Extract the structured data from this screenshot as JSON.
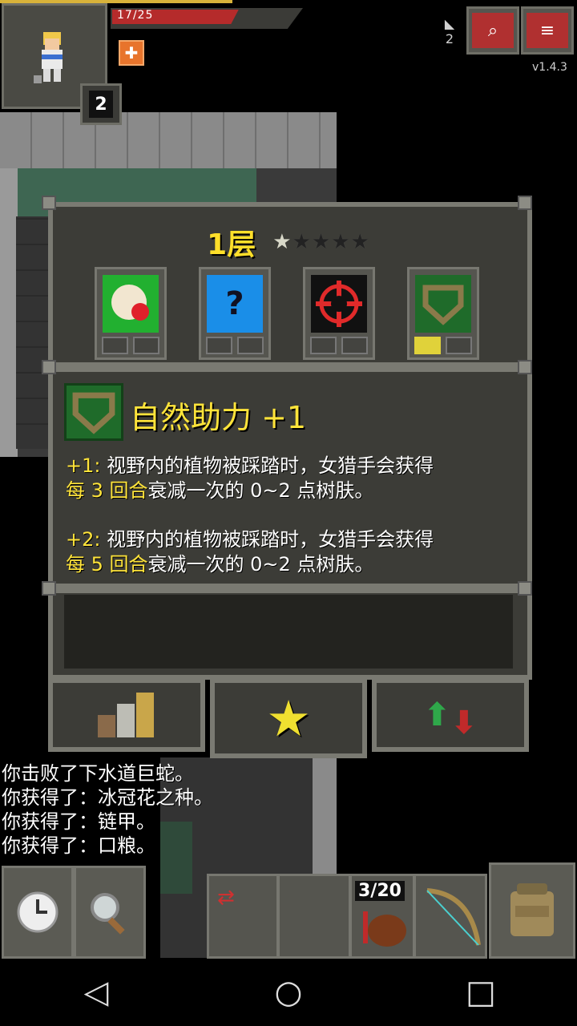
{
  "status": {
    "hp_text": "17/25",
    "hp_fraction": 0.68,
    "level": "2",
    "depth": "2",
    "version": "v1.4.3",
    "buff_icon": "plus-buff-icon"
  },
  "top_buttons": [
    {
      "name": "journal-search-button",
      "icon": "magnifier-book-icon"
    },
    {
      "name": "menu-button",
      "icon": "menu-lines-icon"
    }
  ],
  "window": {
    "floor_label": "1层",
    "stars": [
      "on",
      "off",
      "off",
      "off",
      "off"
    ],
    "talent_slots": [
      {
        "name": "talent-slot-1",
        "icon": "food-plate-icon",
        "color": "#22b030",
        "pips": [
          "empty",
          "empty"
        ]
      },
      {
        "name": "talent-slot-2",
        "icon": "question-mark-icon",
        "color": "#1a8ee8",
        "pips": [
          "empty",
          "empty"
        ]
      },
      {
        "name": "talent-slot-3",
        "icon": "crosshair-icon",
        "color": "#111111",
        "pips": [
          "empty",
          "empty"
        ]
      },
      {
        "name": "talent-slot-4",
        "icon": "shield-icon",
        "color": "#1f6b2a",
        "pips": [
          "gold",
          "empty"
        ]
      }
    ],
    "selected_talent": {
      "name": "自然助力 +1",
      "desc1_prefix": "+1:",
      "desc1_text": "  视野内的植物被踩踏时，女猎手会获得",
      "desc1_highlight": "每 3 回合",
      "desc1_tail": "衰减一次的 0~2 点树肤。",
      "desc2_prefix": "+2:",
      "desc2_text": "  视野内的植物被踩踏时，女猎手会获得",
      "desc2_highlight": "每 5 回合",
      "desc2_tail": "衰减一次的 0~2 点树肤。"
    },
    "tabs": [
      {
        "name": "tab-stats",
        "icon": "stats-bars-icon"
      },
      {
        "name": "tab-talents",
        "icon": "star-icon"
      },
      {
        "name": "tab-upgrade",
        "icon": "up-down-arrows-icon"
      }
    ]
  },
  "log": [
    "你击败了下水道巨蛇。",
    "你获得了：冰冠花之种。",
    "你获得了：链甲。",
    "你获得了：口粮。"
  ],
  "toolbar": {
    "wait": "clock-icon",
    "search": "magnifier-icon",
    "swap": "swap-arrows-icon",
    "ammo_count": "3/20",
    "quick_item": "ammo-pouch-icon",
    "weapon": "bow-icon",
    "backpack": "backpack-icon"
  },
  "navbar": {
    "back": "◁",
    "home": "○",
    "recent": "□"
  }
}
